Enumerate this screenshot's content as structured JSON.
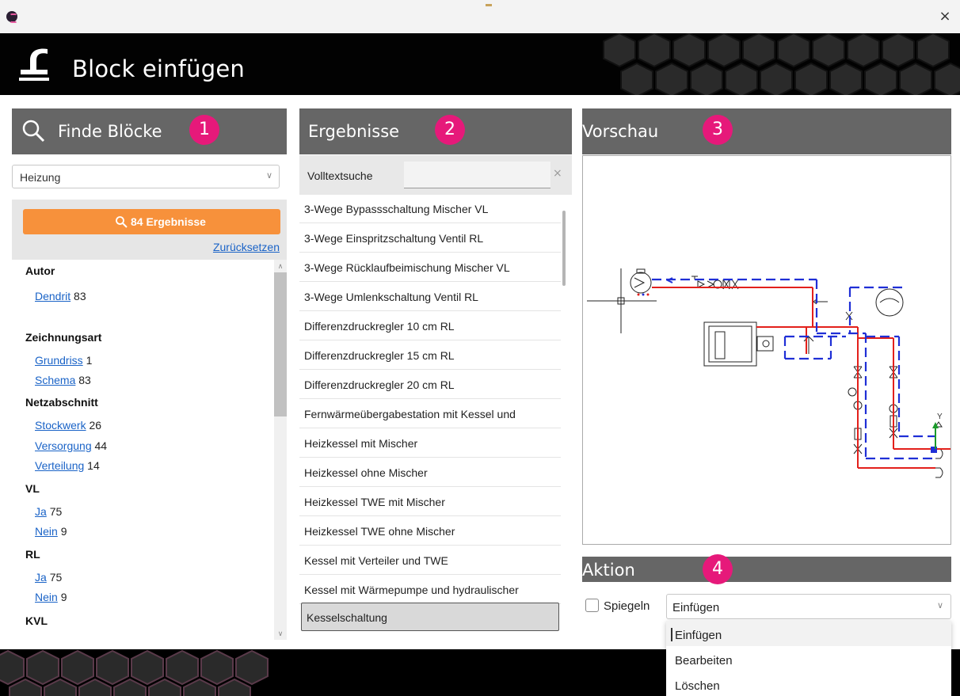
{
  "window": {
    "close_glyph": "×"
  },
  "header": {
    "title": "Block einfügen",
    "icon": "insert-block-icon"
  },
  "panels": {
    "find": {
      "title": "Finde Blöcke",
      "badge": "1",
      "icon": "search-icon"
    },
    "results": {
      "title": "Ergebnisse",
      "badge": "2"
    },
    "preview": {
      "title": "Vorschau",
      "badge": "3"
    },
    "action": {
      "title": "Aktion",
      "badge": "4"
    }
  },
  "find": {
    "category_value": "Heizung",
    "search_button_label": "84 Ergebnisse",
    "reset_link": "Zurücksetzen",
    "facets": [
      {
        "heading": "Autor",
        "items": [
          {
            "label": "Dendrit",
            "count": "83"
          }
        ]
      },
      {
        "heading": "Zeichnungsart",
        "items": [
          {
            "label": "Grundriss",
            "count": "1"
          },
          {
            "label": "Schema",
            "count": "83"
          }
        ]
      },
      {
        "heading": "Netzabschnitt",
        "items": [
          {
            "label": "Stockwerk",
            "count": "26"
          },
          {
            "label": "Versorgung",
            "count": "44"
          },
          {
            "label": "Verteilung",
            "count": "14"
          }
        ]
      },
      {
        "heading": "VL",
        "items": [
          {
            "label": "Ja",
            "count": "75"
          },
          {
            "label": "Nein",
            "count": "9"
          }
        ]
      },
      {
        "heading": "RL",
        "items": [
          {
            "label": "Ja",
            "count": "75"
          },
          {
            "label": "Nein",
            "count": "9"
          }
        ]
      },
      {
        "heading": "KVL",
        "items": []
      }
    ]
  },
  "results": {
    "fulltext_label": "Volltextsuche",
    "fulltext_value": "",
    "clear_glyph": "×",
    "items": [
      "3-Wege Bypassschaltung Mischer VL",
      "3-Wege Einspritzschaltung Ventil RL",
      "3-Wege Rücklaufbeimischung Mischer VL",
      "3-Wege Umlenkschaltung Ventil RL",
      "Differenzdruckregler 10 cm RL",
      "Differenzdruckregler 15 cm RL",
      "Differenzdruckregler 20 cm RL",
      "Fernwärmeübergabestation mit Kessel und",
      "Heizkessel mit Mischer",
      "Heizkessel ohne Mischer",
      "Heizkessel TWE mit Mischer",
      "Heizkessel TWE ohne Mischer",
      "Kessel mit Verteiler und TWE",
      "Kessel mit Wärmepumpe und hydraulischer",
      "Kesselschaltung"
    ],
    "selected_index": 14
  },
  "preview": {
    "axis_label": "Y"
  },
  "action": {
    "mirror_label": "Spiegeln",
    "mirror_checked": false,
    "selected": "Einfügen",
    "options": [
      "Einfügen",
      "Bearbeiten",
      "Löschen"
    ]
  },
  "colors": {
    "accent_orange": "#f7913b",
    "badge_pink": "#e6197a",
    "section_gray": "#666666",
    "link_blue": "#1a63c7",
    "pipe_red": "#e3201b",
    "pipe_blue": "#1f2fd6"
  }
}
